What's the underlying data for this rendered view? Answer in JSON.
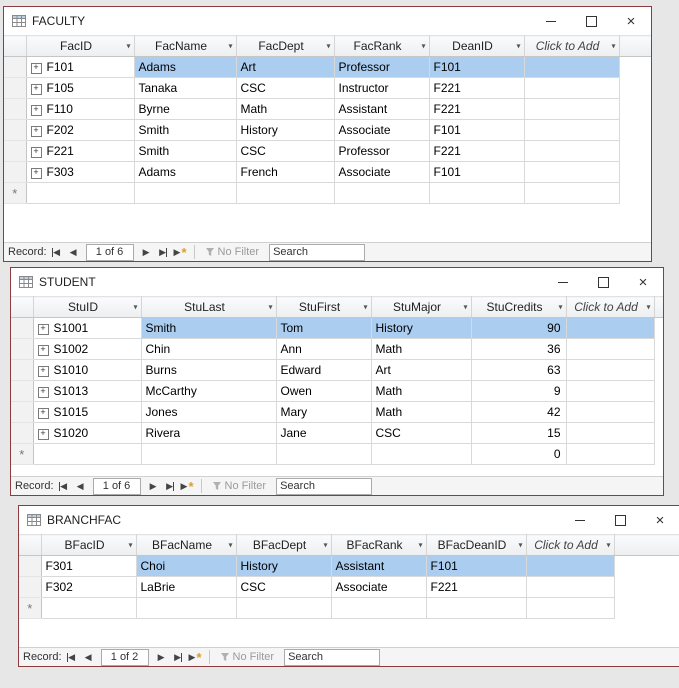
{
  "colors": {
    "window_border": "#8e3b3f",
    "selection": "#aacdf0",
    "desktop": "#e7e7e7"
  },
  "icons": {
    "dropdown": "▾",
    "expander": "+",
    "asterisk": "*",
    "close": "×",
    "nav_prev": "◀",
    "nav_next": "▶"
  },
  "faculty": {
    "title": "FACULTY",
    "columns": [
      "FacID",
      "FacName",
      "FacDept",
      "FacRank",
      "DeanID"
    ],
    "click_to_add": "Click to Add",
    "rows": [
      [
        "F101",
        "Adams",
        "Art",
        "Professor",
        "F101"
      ],
      [
        "F105",
        "Tanaka",
        "CSC",
        "Instructor",
        "F221"
      ],
      [
        "F110",
        "Byrne",
        "Math",
        "Assistant",
        "F221"
      ],
      [
        "F202",
        "Smith",
        "History",
        "Associate",
        "F101"
      ],
      [
        "F221",
        "Smith",
        "CSC",
        "Professor",
        "F221"
      ],
      [
        "F303",
        "Adams",
        "French",
        "Associate",
        "F101"
      ]
    ],
    "nav": {
      "record_label": "Record:",
      "position": "1 of 6",
      "no_filter": "No Filter",
      "search": "Search"
    }
  },
  "student": {
    "title": "STUDENT",
    "columns": [
      "StuID",
      "StuLast",
      "StuFirst",
      "StuMajor",
      "StuCredits"
    ],
    "click_to_add": "Click to Add",
    "rows": [
      [
        "S1001",
        "Smith",
        "Tom",
        "History",
        90
      ],
      [
        "S1002",
        "Chin",
        "Ann",
        "Math",
        36
      ],
      [
        "S1010",
        "Burns",
        "Edward",
        "Art",
        63
      ],
      [
        "S1013",
        "McCarthy",
        "Owen",
        "Math",
        9
      ],
      [
        "S1015",
        "Jones",
        "Mary",
        "Math",
        42
      ],
      [
        "S1020",
        "Rivera",
        "Jane",
        "CSC",
        15
      ]
    ],
    "new_row_default": 0,
    "nav": {
      "record_label": "Record:",
      "position": "1 of 6",
      "no_filter": "No Filter",
      "search": "Search"
    }
  },
  "branchfac": {
    "title": "BRANCHFAC",
    "columns": [
      "BFacID",
      "BFacName",
      "BFacDept",
      "BFacRank",
      "BFacDeanID"
    ],
    "click_to_add": "Click to Add",
    "rows": [
      [
        "F301",
        "Choi",
        "History",
        "Assistant",
        "F101"
      ],
      [
        "F302",
        "LaBrie",
        "CSC",
        "Associate",
        "F221"
      ]
    ],
    "nav": {
      "record_label": "Record:",
      "position": "1 of 2",
      "no_filter": "No Filter",
      "search": "Search"
    }
  }
}
